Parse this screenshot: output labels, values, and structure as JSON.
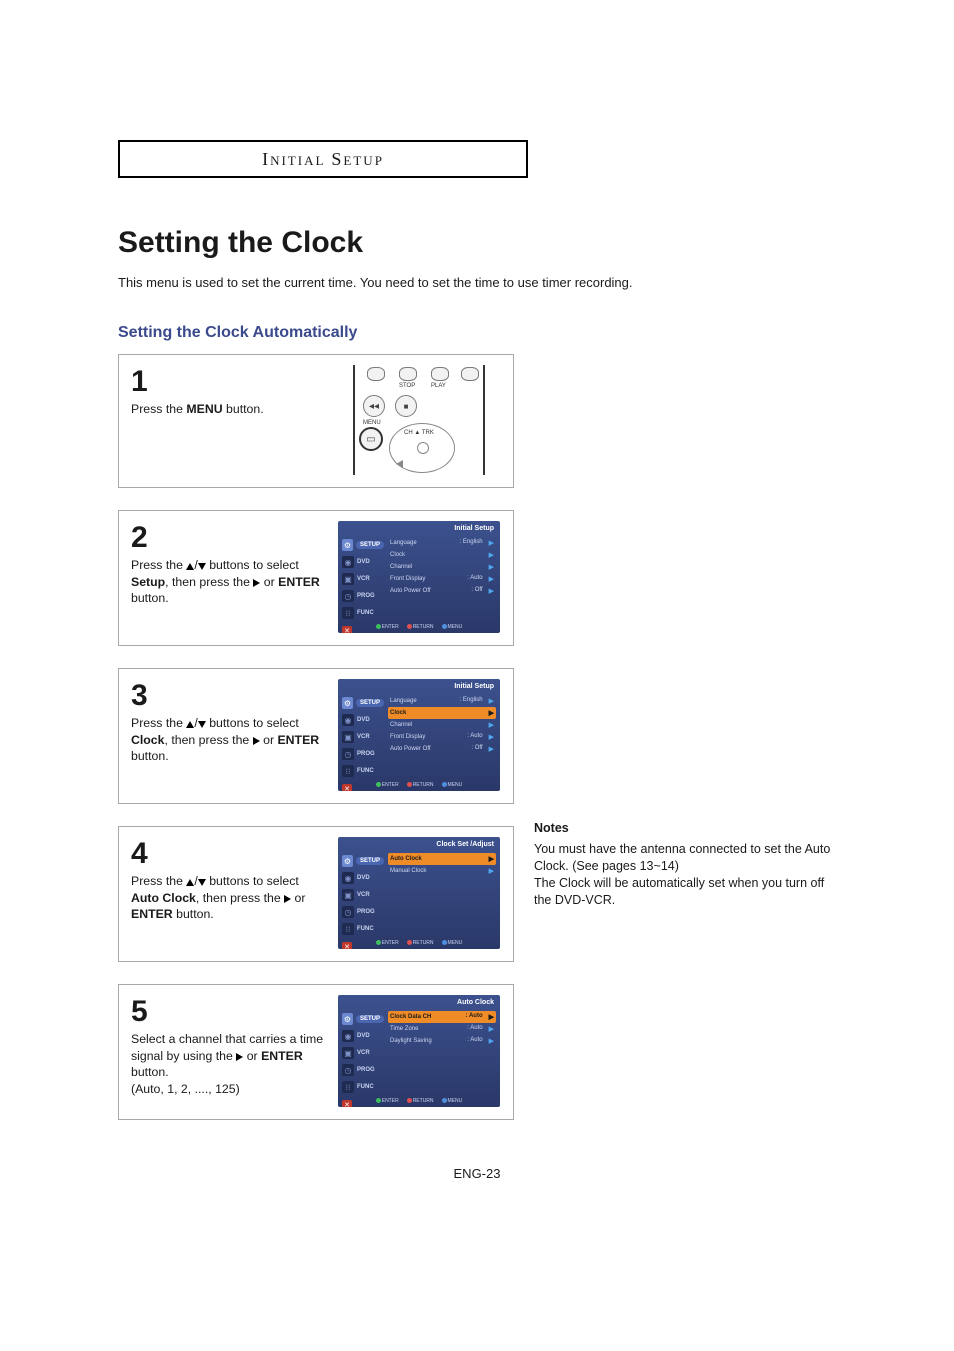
{
  "breadcrumb": {
    "line": "INITIAL SETUP"
  },
  "title": "Setting the Clock",
  "intro": {
    "s1": "This menu is used to set the current time.",
    "s2": "You need to set the time to use timer recording."
  },
  "subtitle": "Setting the Clock Automatically",
  "steps": {
    "1": {
      "num": "1",
      "pre1": "Press the ",
      "bold1": "MENU",
      "post1": " button."
    },
    "2": {
      "num": "2",
      "pre1": "Press the ",
      "mid1": " buttons to select ",
      "bold1": "Setup",
      "mid2": ", then press the ",
      "mid3": " or ",
      "bold2": "ENTER",
      "post1": " button."
    },
    "3": {
      "num": "3",
      "pre1": "Press the ",
      "mid1": " buttons to select ",
      "bold1": "Clock",
      "mid2": ", then press the ",
      "mid3": " or ",
      "bold2": "ENTER",
      "post1": " button."
    },
    "4": {
      "num": "4",
      "pre1": "Press the ",
      "mid1": " buttons to select ",
      "bold1": "Auto Clock",
      "mid2": ", then press the ",
      "mid3": " or ",
      "bold2": "ENTER",
      "post1": " button."
    },
    "5": {
      "num": "5",
      "pre1": "Select a channel that carries a time signal by using the ",
      "mid3": " or ",
      "bold2": "ENTER",
      "post1": " button.",
      "line2": "(Auto, 1, 2, ...., 125)"
    }
  },
  "osd": {
    "sidebar": [
      "SETUP",
      "DVD",
      "VCR",
      "PROG",
      "FUNC"
    ],
    "exit": "✕",
    "footer": {
      "enter": "ENTER",
      "return": "RETURN",
      "menu": "MENU"
    },
    "screen2": {
      "title": "Initial Setup",
      "rows": [
        {
          "label": "Language",
          "value": ": English",
          "hl": false
        },
        {
          "label": "Clock",
          "value": "",
          "hl": false
        },
        {
          "label": "Channel",
          "value": "",
          "hl": false
        },
        {
          "label": "Front Display",
          "value": ": Auto",
          "hl": false
        },
        {
          "label": "Auto Power Off",
          "value": ": Off",
          "hl": false
        }
      ],
      "active_sidebar": 0
    },
    "screen3": {
      "title": "Initial Setup",
      "rows": [
        {
          "label": "Language",
          "value": ": English",
          "hl": false
        },
        {
          "label": "Clock",
          "value": "",
          "hl": true
        },
        {
          "label": "Channel",
          "value": "",
          "hl": false
        },
        {
          "label": "Front Display",
          "value": ": Auto",
          "hl": false
        },
        {
          "label": "Auto Power Off",
          "value": ": Off",
          "hl": false
        }
      ],
      "active_sidebar": 0
    },
    "screen4": {
      "title": "Clock Set /Adjust",
      "rows": [
        {
          "label": "Auto Clock",
          "value": "",
          "hl": true
        },
        {
          "label": "Manual Clock",
          "value": "",
          "hl": false
        }
      ],
      "active_sidebar": 0
    },
    "screen5": {
      "title": "Auto Clock",
      "rows": [
        {
          "label": "Clock Data CH",
          "value": ": Auto",
          "hl": true
        },
        {
          "label": "Time Zone",
          "value": ": Auto",
          "hl": false
        },
        {
          "label": "Daylight Saving",
          "value": ": Auto",
          "hl": false
        }
      ],
      "active_sidebar": 0
    }
  },
  "remote": {
    "stop": "STOP",
    "play": "PLAY",
    "menu": "MENU",
    "ch_trk": "CH ▲ TRK"
  },
  "notes": {
    "title": "Notes",
    "p1": "You must have the antenna connected to set the Auto Clock. (See pages 13~14)",
    "p2": "The Clock will be automatically set when you turn off the DVD-VCR."
  },
  "page_num": "ENG-23"
}
